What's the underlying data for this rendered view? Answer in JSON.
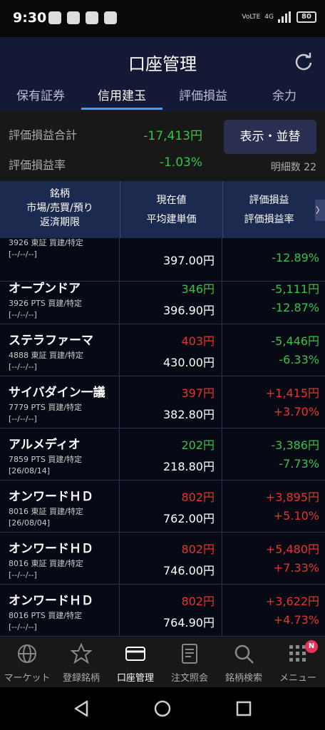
{
  "status_bar": {
    "time": "9:30",
    "net_label": "VoLTE",
    "signal_label": "4G",
    "battery": "80"
  },
  "header": {
    "title": "口座管理"
  },
  "tabs": [
    {
      "label": "保有証券"
    },
    {
      "label": "信用建玉"
    },
    {
      "label": "評価損益"
    },
    {
      "label": "余力"
    }
  ],
  "summary": {
    "total_label": "評価損益合計",
    "total_value": "-17,413円",
    "rate_label": "評価損益率",
    "rate_value": "-1.03%",
    "button_label": "表示・並替",
    "count_text": "明細数 22"
  },
  "table_header": {
    "col1": [
      "銘柄",
      "市場/売買/預り",
      "返済期限"
    ],
    "col2": [
      "現在値",
      "平均建単価"
    ],
    "col3": [
      "評価損益",
      "評価損益率"
    ],
    "more": "〉"
  },
  "rows": [
    {
      "name": "",
      "sub": "3926 東証 買建/特定",
      "date": "[--/--/--]",
      "price": "",
      "avg": "397.00円",
      "pl": "",
      "plr": "-12.89%",
      "price_dir": "down",
      "pl_dir": "down"
    },
    {
      "name": "オープンドア",
      "sub": "3926 PTS 買建/特定",
      "date": "[--/--/--]",
      "price": "346円",
      "avg": "396.90円",
      "pl": "-5,111円",
      "plr": "-12.87%",
      "price_dir": "down",
      "pl_dir": "down"
    },
    {
      "name": "ステラファーマ",
      "sub": "4888 東証 買建/特定",
      "date": "[--/--/--]",
      "price": "403円",
      "avg": "430.00円",
      "pl": "-5,446円",
      "plr": "-6.33%",
      "price_dir": "up",
      "pl_dir": "down"
    },
    {
      "name": "サイバダイン一議",
      "sub": "7779 PTS 買建/特定",
      "date": "[--/--/--]",
      "price": "397円",
      "avg": "382.80円",
      "pl": "+1,415円",
      "plr": "+3.70%",
      "price_dir": "up",
      "pl_dir": "up"
    },
    {
      "name": "アルメディオ",
      "sub": "7859 PTS 買建/特定",
      "date": "[26/08/14]",
      "price": "202円",
      "avg": "218.80円",
      "pl": "-3,386円",
      "plr": "-7.73%",
      "price_dir": "down",
      "pl_dir": "down"
    },
    {
      "name": "オンワードＨＤ",
      "sub": "8016 東証 買建/特定",
      "date": "[26/08/04]",
      "price": "802円",
      "avg": "762.00円",
      "pl": "+3,895円",
      "plr": "+5.10%",
      "price_dir": "up",
      "pl_dir": "up"
    },
    {
      "name": "オンワードＨＤ",
      "sub": "8016 東証 買建/特定",
      "date": "[--/--/--]",
      "price": "802円",
      "avg": "746.00円",
      "pl": "+5,480円",
      "plr": "+7.33%",
      "price_dir": "up",
      "pl_dir": "up"
    },
    {
      "name": "オンワードＨＤ",
      "sub": "8016 PTS 買建/特定",
      "date": "[--/--/--]",
      "price": "802円",
      "avg": "764.90円",
      "pl": "+3,622円",
      "plr": "+4.73%",
      "price_dir": "up",
      "pl_dir": "up"
    }
  ],
  "bottom_nav": [
    {
      "label": "マーケット",
      "icon": "globe-icon"
    },
    {
      "label": "登録銘柄",
      "icon": "star-icon"
    },
    {
      "label": "口座管理",
      "icon": "card-icon",
      "active": true
    },
    {
      "label": "注文照会",
      "icon": "document-icon"
    },
    {
      "label": "銘柄検索",
      "icon": "search-icon"
    },
    {
      "label": "メニュー",
      "icon": "grid-icon",
      "badge": "N"
    }
  ],
  "colors": {
    "up": "#e7342b",
    "down": "#37c24a",
    "header_bg": "#141a36",
    "accent": "#3aa0ff"
  }
}
